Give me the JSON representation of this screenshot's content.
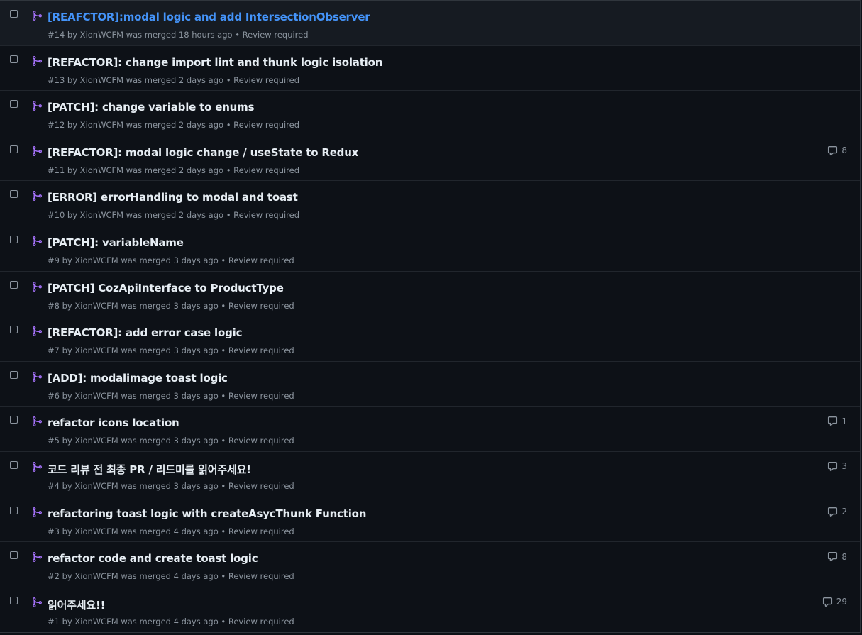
{
  "colors": {
    "background": "#0d1117",
    "title": "#e6edf3",
    "title_hover": "#4493f8",
    "meta": "#8b949e",
    "merged_icon": "#a371f7"
  },
  "pull_requests": [
    {
      "title": "[REAFCTOR]:modal logic and add IntersectionObserver",
      "meta": "#14 by XionWCFM was merged 18 hours ago • Review required",
      "comments": null,
      "hovered": true
    },
    {
      "title": "[REFACTOR]: change import lint and thunk logic isolation",
      "meta": "#13 by XionWCFM was merged 2 days ago • Review required",
      "comments": null
    },
    {
      "title": "[PATCH]: change variable to enums",
      "meta": "#12 by XionWCFM was merged 2 days ago • Review required",
      "comments": null
    },
    {
      "title": "[REFACTOR]: modal logic change / useState to Redux",
      "meta": "#11 by XionWCFM was merged 2 days ago • Review required",
      "comments": "8"
    },
    {
      "title": "[ERROR] errorHandling to modal and toast",
      "meta": "#10 by XionWCFM was merged 2 days ago • Review required",
      "comments": null
    },
    {
      "title": "[PATCH]: variableName",
      "meta": "#9 by XionWCFM was merged 3 days ago • Review required",
      "comments": null
    },
    {
      "title": "[PATCH] CozApiInterface to ProductType",
      "meta": "#8 by XionWCFM was merged 3 days ago • Review required",
      "comments": null
    },
    {
      "title": "[REFACTOR]: add error case logic",
      "meta": "#7 by XionWCFM was merged 3 days ago • Review required",
      "comments": null
    },
    {
      "title": "[ADD]: modalimage toast logic",
      "meta": "#6 by XionWCFM was merged 3 days ago • Review required",
      "comments": null
    },
    {
      "title": "refactor icons location",
      "meta": "#5 by XionWCFM was merged 3 days ago • Review required",
      "comments": "1"
    },
    {
      "title": "코드 리뷰 전 최종 PR / 리드미를 읽어주세요!",
      "meta": "#4 by XionWCFM was merged 3 days ago • Review required",
      "comments": "3"
    },
    {
      "title": "refactoring toast logic with createAsycThunk Function",
      "meta": "#3 by XionWCFM was merged 4 days ago • Review required",
      "comments": "2"
    },
    {
      "title": "refactor code and create toast logic",
      "meta": "#2 by XionWCFM was merged 4 days ago • Review required",
      "comments": "8"
    },
    {
      "title": "읽어주세요!!",
      "meta": "#1 by XionWCFM was merged 4 days ago • Review required",
      "comments": "29"
    }
  ]
}
